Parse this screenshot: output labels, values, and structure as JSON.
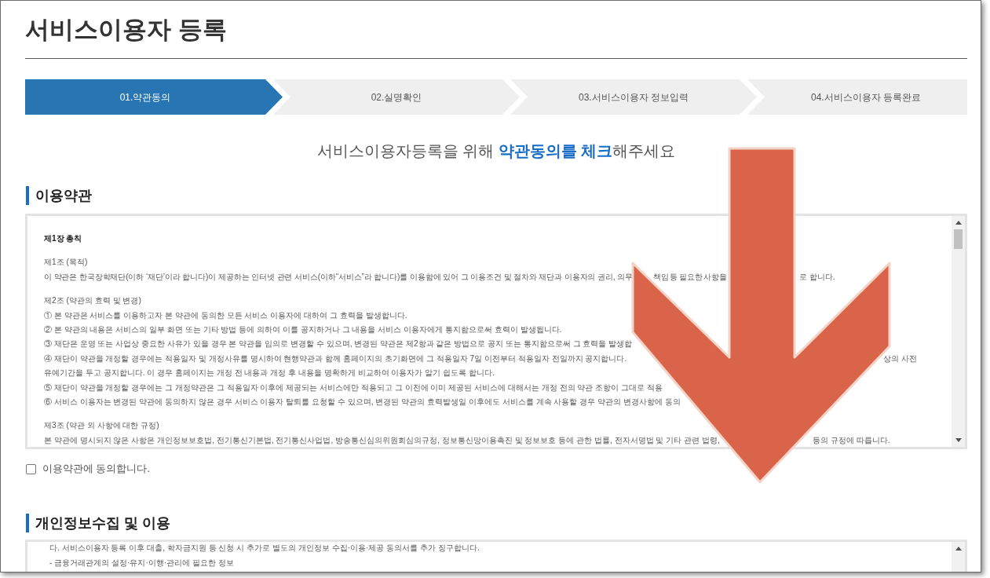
{
  "page_title": "서비스이용자 등록",
  "steps": [
    {
      "label": "01.약관동의",
      "selected": true
    },
    {
      "label": "02.실명확인",
      "selected": false
    },
    {
      "label": "03.서비스이용자 정보입력",
      "selected": false
    },
    {
      "label": "04.서비스이용자 등록완료",
      "selected": false
    }
  ],
  "instruction": "서비스이용자등록을 위해 **약관동의를 체크**해주세요",
  "terms": {
    "heading": "이용약관",
    "lines": [
      {
        "kind": "chapter",
        "text": "제1장 총칙"
      },
      {
        "kind": "article",
        "text": "제1조 (목적)"
      },
      {
        "kind": "body",
        "visible_parts": [
          "이 약관은 한국장학재단(이하 ‘재단’이라 합니다)이 제공하는 인터넷 관련 서비스(이하“서비스”라 합니다)를 이용함에 있어 그 이용조건 및 절차와 재단과 이용자의 권리, 의무",
          "책임 등 필요한 사항을",
          "로 합니다."
        ]
      },
      {
        "kind": "article",
        "text": "제2조 (약관의 효력 및 변경)"
      },
      {
        "kind": "body",
        "text": "① 본 약관은 서비스를 이용하고자 본 약관에 동의한 모든 서비스 이용자에 대하여 그 효력을 발생합니다."
      },
      {
        "kind": "body",
        "text": "② 본 약관의 내용은 서비스의 일부 화면 또는 기타 방법 등에 의하여 이를 공지하거나 그 내용을 서비스 이용자에게 통지함으로써 효력이 발생됩니다."
      },
      {
        "kind": "body",
        "text": "③ 재단은 운영 또는 사업상 중요한 사유가 있을 경우 본 약관을 임의로 변경할 수 있으며, 변경된 약관은 제2항과 같은 방법으로 공지 또는 통지함으로써 그 효력을 발생합"
      },
      {
        "kind": "body",
        "visible_parts": [
          "④ 재단이 약관을 개정할 경우에는 적용일자 및 개정사유를 명시하여 현행약관과 함께 홈페이지의 초기화면에 그 적용일자 7일 이전부터 적용일자 전일까지 공지합니다.",
          "상의 사전"
        ]
      },
      {
        "kind": "body",
        "text": "유예기간을 두고 공지합니다. 이 경우 홈페이지는 개정 전 내용과 개정 후 내용을 명확하게 비교하여 이용자가 알기 쉽도록 합니다."
      },
      {
        "kind": "body",
        "text": "⑤ 재단이 약관을 개정할 경우에는 그 개정약관은 그 적용일자 이후에 제공되는 서비스에만 적용되고 그 이전에 이미 제공된 서비스에 대해서는 개정 전의 약관 조항이 그대로 적용"
      },
      {
        "kind": "body",
        "text": "⑥ 서비스 이용자는 변경된 약관에 동의하지 않은 경우 서비스 이용자 탈퇴를 요청할 수 있으며, 변경된 약관의 효력발생일 이후에도 서비스를 계속 사용할 경우 약관의 변경사항에 동의"
      },
      {
        "kind": "article",
        "text": "제3조 (약관 외 사항에 대한 규정)"
      },
      {
        "kind": "body",
        "visible_parts": [
          "본 약관에 명시되지 않은 사항은 개인정보보호법, 전기통신기본법, 전기통신사업법, 방송통신심의위원회심의규정, 정보통신망이용촉진 및 정보보호 등에 관한 법률, 전자서명법 및 기타 관련 법령,",
          "등의 규정에 따릅니다."
        ]
      }
    ],
    "agree": {
      "label": "이용약관에 동의합니다.",
      "checked": false
    }
  },
  "privacy": {
    "heading": "개인정보수집 및 이용",
    "lines": [
      "다. 서비스이용자 등록 이후 대출, 학자금지원 등 신청 시 추가로 별도의 개인정보 수집·이용·제공 동의서를 추가 징구합니다.",
      "- 금융거래관계의 설정·유지·이행·관리에 필요한 정보"
    ]
  }
}
